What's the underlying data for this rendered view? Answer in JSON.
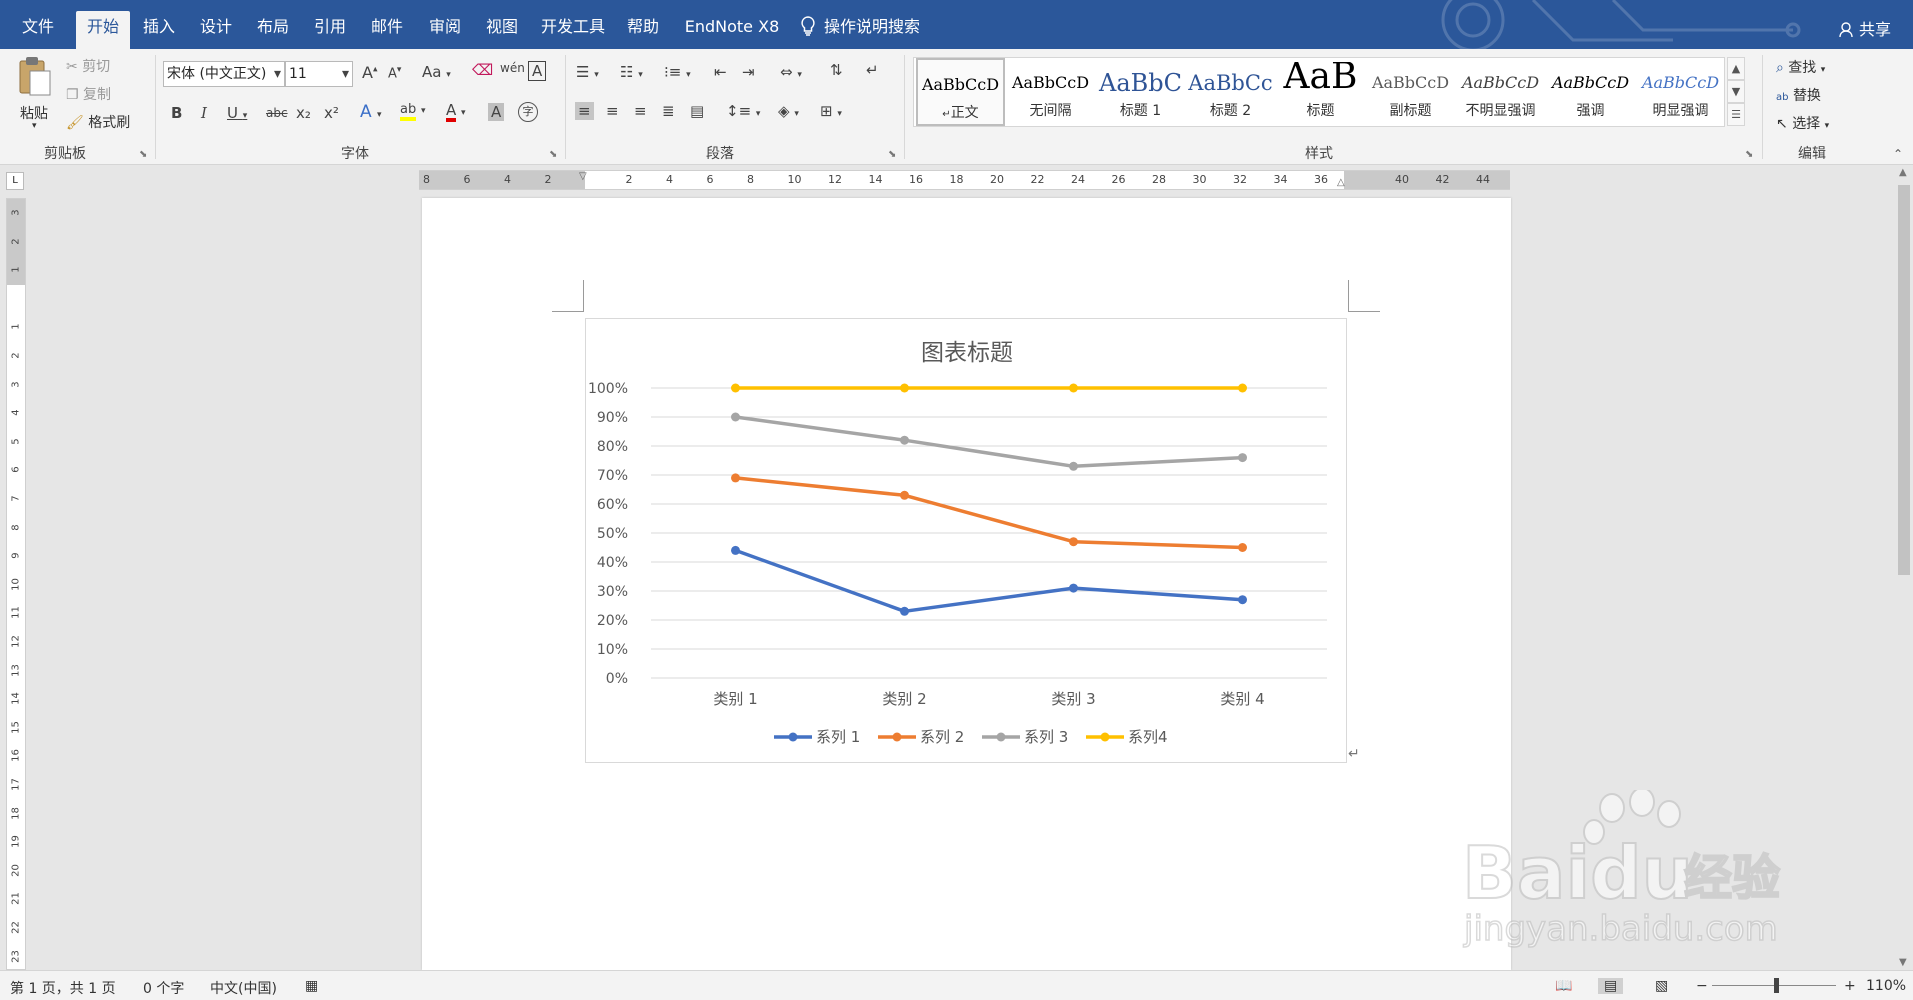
{
  "ribbon_tabs": [
    "文件",
    "开始",
    "插入",
    "设计",
    "布局",
    "引用",
    "邮件",
    "审阅",
    "视图",
    "开发工具",
    "帮助",
    "EndNote X8"
  ],
  "tell_me": "操作说明搜索",
  "share": "共享",
  "clipboard": {
    "paste": "粘贴",
    "cut": "剪切",
    "copy": "复制",
    "format_painter": "格式刷",
    "label": "剪贴板"
  },
  "font": {
    "name": "宋体 (中文正文)",
    "size": "11",
    "label": "字体",
    "grow": "A",
    "shrink": "A",
    "case": "Aa",
    "bold": "B",
    "italic": "I",
    "underline": "U",
    "strike": "abc",
    "sub": "x₂",
    "sup": "x²",
    "effects": "A",
    "color": "A",
    "shade": "A",
    "phonetic": "wén",
    "charborder": "A",
    "enclose": "字"
  },
  "paragraph": {
    "label": "段落"
  },
  "styles": {
    "label": "样式",
    "items": [
      {
        "preview": "AaBbCcD",
        "name": "正文"
      },
      {
        "preview": "AaBbCcD",
        "name": "无间隔"
      },
      {
        "preview": "AaBbC",
        "name": "标题 1"
      },
      {
        "preview": "AaBbCc",
        "name": "标题 2"
      },
      {
        "preview": "AaB",
        "name": "标题"
      },
      {
        "preview": "AaBbCcD",
        "name": "副标题"
      },
      {
        "preview": "AaBbCcD",
        "name": "不明显强调"
      },
      {
        "preview": "AaBbCcD",
        "name": "强调"
      },
      {
        "preview": "AaBbCcD",
        "name": "明显强调"
      }
    ]
  },
  "editing": {
    "find": "查找",
    "replace": "替换",
    "select": "选择",
    "label": "编辑"
  },
  "hruler_labels": [
    "8",
    "6",
    "4",
    "2",
    "",
    "2",
    "4",
    "6",
    "8",
    "10",
    "12",
    "14",
    "16",
    "18",
    "20",
    "22",
    "24",
    "26",
    "28",
    "30",
    "32",
    "34",
    "36",
    "",
    "40",
    "42",
    "44"
  ],
  "vruler_labels": [
    "3",
    "2",
    "1",
    "",
    "1",
    "2",
    "3",
    "4",
    "5",
    "6",
    "7",
    "8",
    "9",
    "10",
    "11",
    "12",
    "13",
    "14",
    "15",
    "16",
    "17",
    "18",
    "19",
    "20",
    "21",
    "22",
    "23"
  ],
  "chart_data": {
    "type": "line",
    "title": "图表标题",
    "categories": [
      "类别 1",
      "类别 2",
      "类别 3",
      "类别 4"
    ],
    "ylim": [
      0,
      1
    ],
    "yticks": [
      "0%",
      "10%",
      "20%",
      "30%",
      "40%",
      "50%",
      "60%",
      "70%",
      "80%",
      "90%",
      "100%"
    ],
    "grid": true,
    "legend": "bottom",
    "series": [
      {
        "name": "系列 1",
        "color": "#4472c4",
        "values": [
          0.44,
          0.23,
          0.31,
          0.27
        ]
      },
      {
        "name": "系列 2",
        "color": "#ed7d31",
        "values": [
          0.69,
          0.63,
          0.47,
          0.45
        ]
      },
      {
        "name": "系列 3",
        "color": "#a5a5a5",
        "values": [
          0.9,
          0.82,
          0.73,
          0.76
        ]
      },
      {
        "name": "系列4",
        "color": "#ffc000",
        "values": [
          1.0,
          1.0,
          1.0,
          1.0
        ]
      }
    ]
  },
  "paragraph_mark": "↵",
  "status": {
    "page": "第 1 页，共 1 页",
    "words": "0 个字",
    "lang": "中文(中国)",
    "zoom": "110%"
  },
  "watermark": {
    "brand": "Baidu",
    "sub": "经验",
    "url": "jingyan.baidu.com"
  }
}
